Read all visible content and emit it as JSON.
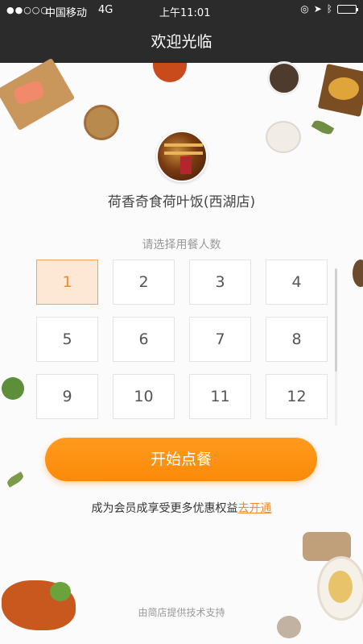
{
  "status_bar": {
    "signal": "●●○○○",
    "carrier": "中国移动",
    "network": "4G",
    "time": "上午11:01"
  },
  "nav": {
    "title": "欢迎光临"
  },
  "store": {
    "name": "荷香奇食荷叶饭(西湖店)"
  },
  "party_size": {
    "prompt": "请选择用餐人数",
    "options": [
      "1",
      "2",
      "3",
      "4",
      "5",
      "6",
      "7",
      "8",
      "9",
      "10",
      "11",
      "12"
    ],
    "selected": "1"
  },
  "actions": {
    "start_label": "开始点餐"
  },
  "membership": {
    "text": "成为会员成享受更多优惠权益",
    "link": "去开通"
  },
  "footer": {
    "text": "由简店提供技术支持"
  },
  "colors": {
    "accent": "#fb8a08",
    "nav_bg": "#2b2b2b",
    "selected_bg": "#fde8d6"
  }
}
